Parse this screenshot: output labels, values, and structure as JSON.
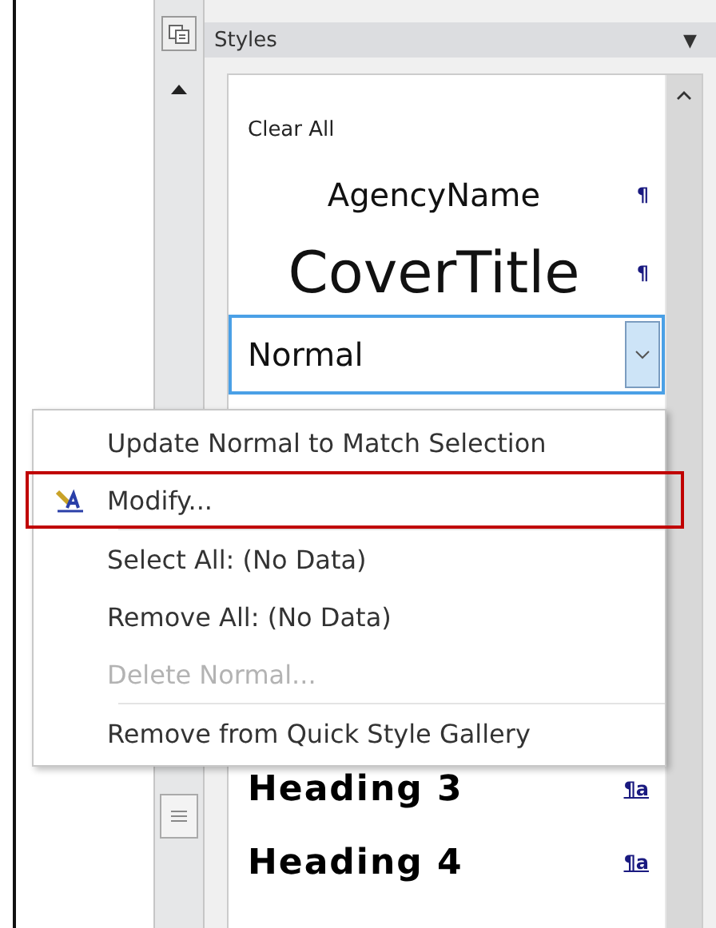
{
  "pane": {
    "title": "Styles",
    "menu_glyph": "▼"
  },
  "styles": [
    {
      "name": "Clear All",
      "kind": "clear"
    },
    {
      "name": "AgencyName",
      "kind": "agency",
      "mark": "¶"
    },
    {
      "name": "CoverTitle",
      "kind": "cover",
      "mark": "¶"
    },
    {
      "name": "Normal",
      "kind": "current"
    },
    {
      "name": "Heading 3",
      "kind": "heading",
      "mark": "¶a"
    },
    {
      "name": "Heading 4",
      "kind": "heading",
      "mark": "¶a"
    }
  ],
  "context_menu": [
    {
      "kind": "item",
      "label": "Update Normal to Match Selection",
      "disabled": false,
      "selected": false,
      "icon": false
    },
    {
      "kind": "item",
      "label": "Modify...",
      "disabled": false,
      "selected": true,
      "icon": true
    },
    {
      "kind": "separator"
    },
    {
      "kind": "item",
      "label": "Select All: (No Data)",
      "disabled": false,
      "selected": false,
      "icon": false
    },
    {
      "kind": "item",
      "label": "Remove All: (No Data)",
      "disabled": false,
      "selected": false,
      "icon": false
    },
    {
      "kind": "item",
      "label": "Delete Normal...",
      "disabled": true,
      "selected": false,
      "icon": false
    },
    {
      "kind": "separator"
    },
    {
      "kind": "item",
      "label": "Remove from Quick Style Gallery",
      "disabled": false,
      "selected": false,
      "icon": false
    }
  ]
}
